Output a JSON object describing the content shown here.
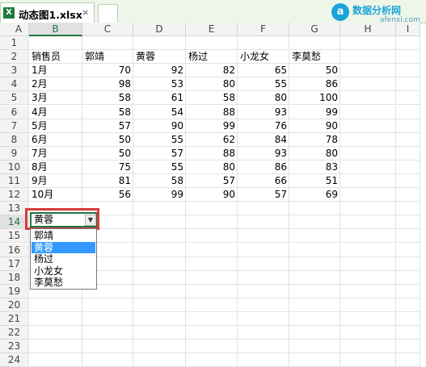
{
  "tab": {
    "title": "动态图1.xlsx",
    "close": "×",
    "icon": "X"
  },
  "logo": {
    "mark": "a",
    "text": "数据分析网",
    "url": "afenxi.com"
  },
  "columns": [
    "A",
    "B",
    "C",
    "D",
    "E",
    "F",
    "G",
    "H",
    "I"
  ],
  "selected_column": "B",
  "rows": [
    "1",
    "2",
    "3",
    "4",
    "5",
    "6",
    "7",
    "8",
    "9",
    "10",
    "11",
    "12",
    "13",
    "14",
    "15",
    "16",
    "17",
    "18",
    "19",
    "20",
    "21",
    "22",
    "23",
    "24"
  ],
  "selected_row": "14",
  "table": {
    "headers": [
      "销售员",
      "郭靖",
      "黄蓉",
      "杨过",
      "小龙女",
      "李莫愁"
    ],
    "rows": [
      [
        "1月",
        "70",
        "92",
        "82",
        "65",
        "50"
      ],
      [
        "2月",
        "98",
        "53",
        "80",
        "55",
        "86"
      ],
      [
        "3月",
        "58",
        "61",
        "58",
        "80",
        "100"
      ],
      [
        "4月",
        "58",
        "54",
        "88",
        "93",
        "99"
      ],
      [
        "5月",
        "57",
        "90",
        "99",
        "76",
        "90"
      ],
      [
        "6月",
        "50",
        "55",
        "62",
        "84",
        "78"
      ],
      [
        "7月",
        "50",
        "57",
        "88",
        "93",
        "80"
      ],
      [
        "8月",
        "75",
        "55",
        "80",
        "86",
        "83"
      ],
      [
        "9月",
        "81",
        "58",
        "57",
        "66",
        "51"
      ],
      [
        "10月",
        "56",
        "99",
        "90",
        "57",
        "69"
      ]
    ]
  },
  "dropdown": {
    "value": "黄蓉",
    "arrow": "▼",
    "options": [
      "郭靖",
      "黄蓉",
      "杨过",
      "小龙女",
      "李莫愁"
    ],
    "selected_index": 1
  },
  "colors": {
    "highlight": "#d93a3a",
    "selection": "#3399ff",
    "excel_green": "#217346"
  }
}
